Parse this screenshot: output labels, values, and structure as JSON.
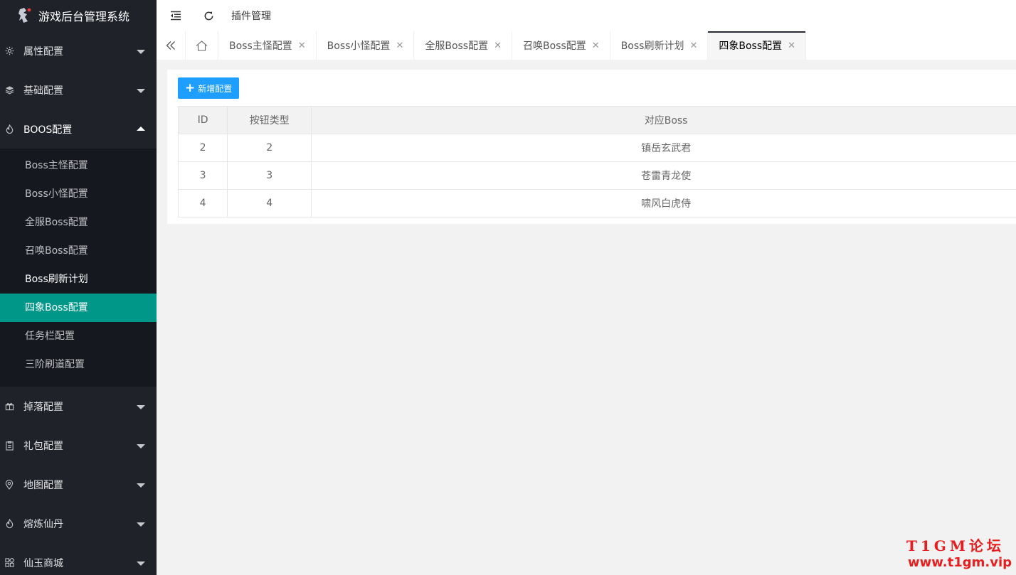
{
  "app": {
    "title": "游戏后台管理系统"
  },
  "sidebar": {
    "items": [
      {
        "label": "属性配置",
        "icon": "gear-icon",
        "expanded": false
      },
      {
        "label": "基础配置",
        "icon": "layers-icon",
        "expanded": false
      },
      {
        "label": "BOOS配置",
        "icon": "fire-icon",
        "expanded": true
      },
      {
        "label": "掉落配置",
        "icon": "gift-icon",
        "expanded": false
      },
      {
        "label": "礼包配置",
        "icon": "clipboard-icon",
        "expanded": false
      },
      {
        "label": "地图配置",
        "icon": "location-icon",
        "expanded": false
      },
      {
        "label": "熔炼仙丹",
        "icon": "fire-icon",
        "expanded": false
      },
      {
        "label": "仙玉商城",
        "icon": "apps-icon",
        "expanded": false
      }
    ],
    "boss_submenu": [
      "Boss主怪配置",
      "Boss小怪配置",
      "全服Boss配置",
      "召唤Boss配置",
      "Boss刷新计划",
      "四象Boss配置",
      "任务栏配置",
      "三阶刷道配置"
    ],
    "active_submenu": "四象Boss配置"
  },
  "header": {
    "plugin_label": "插件管理"
  },
  "tabs": [
    {
      "label": "Boss主怪配置",
      "active": false
    },
    {
      "label": "Boss小怪配置",
      "active": false
    },
    {
      "label": "全服Boss配置",
      "active": false
    },
    {
      "label": "召唤Boss配置",
      "active": false
    },
    {
      "label": "Boss刷新计划",
      "active": false
    },
    {
      "label": "四象Boss配置",
      "active": true
    }
  ],
  "toolbar": {
    "add_label": "新增配置"
  },
  "table": {
    "headers": {
      "id": "ID",
      "type": "按钮类型",
      "boss": "对应Boss"
    },
    "rows": [
      {
        "id": "2",
        "type": "2",
        "boss": "镇岳玄武君"
      },
      {
        "id": "3",
        "type": "3",
        "boss": "苍雷青龙使"
      },
      {
        "id": "4",
        "type": "4",
        "boss": "啸风白虎侍"
      }
    ]
  },
  "watermark": {
    "line1": "T1GM论坛",
    "line2": "www.t1gm.vip"
  },
  "colors": {
    "sidebar_bg": "#20222a",
    "active_green": "#009688",
    "primary_blue": "#1e9fff",
    "watermark_red": "#e81d1d"
  }
}
